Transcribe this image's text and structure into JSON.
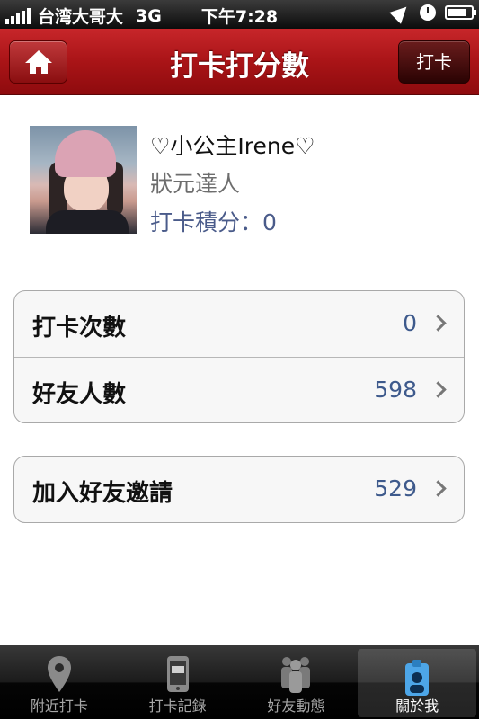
{
  "status_bar": {
    "carrier": "台湾大哥大",
    "network": "3G",
    "time": "下午7:28"
  },
  "nav": {
    "title": "打卡打分數",
    "right_button": "打卡",
    "home_icon": "home-icon"
  },
  "profile": {
    "name": "♡小公主Irene♡",
    "rank": "狀元達人",
    "score": "打卡積分：0"
  },
  "stats_group": [
    {
      "label": "打卡次數",
      "value": "0"
    },
    {
      "label": "好友人數",
      "value": "598"
    }
  ],
  "invite_group": [
    {
      "label": "加入好友邀請",
      "value": "529"
    }
  ],
  "tabs": [
    {
      "label": "附近打卡",
      "icon": "location-pin-icon",
      "active": false
    },
    {
      "label": "打卡記錄",
      "icon": "phone-record-icon",
      "active": false
    },
    {
      "label": "好友動態",
      "icon": "friends-icon",
      "active": false
    },
    {
      "label": "關於我",
      "icon": "profile-badge-icon",
      "active": true
    }
  ],
  "colors": {
    "nav_red": "#a91417",
    "value_blue": "#3e5a8c",
    "score_blue": "#4a5b8a"
  }
}
